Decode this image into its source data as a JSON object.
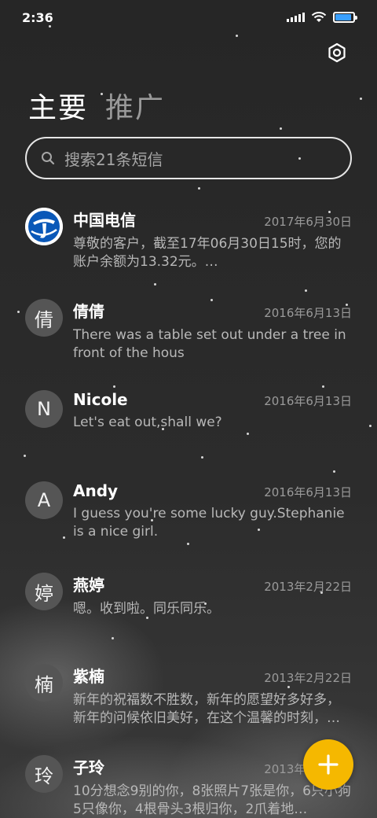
{
  "status_bar": {
    "time": "2:36",
    "icons": [
      "signal-icon",
      "wifi-icon",
      "battery-icon"
    ],
    "battery_level": 0.9
  },
  "header": {
    "settings_icon": "gear-icon",
    "tabs": [
      {
        "label": "主要",
        "active": true
      },
      {
        "label": "推广",
        "active": false
      }
    ]
  },
  "search": {
    "placeholder": "搜索21条短信",
    "icon": "search-icon"
  },
  "messages": [
    {
      "avatar": "",
      "avatar_icon": "china-telecom-logo",
      "name": "中国电信",
      "date": "2017年6月30日",
      "preview": "尊敬的客户，截至17年06月30日15时，您的账户余额为13.32元。…"
    },
    {
      "avatar": "倩",
      "name": "倩倩",
      "date": "2016年6月13日",
      "preview": "There was a table set out under a tree in front of the hous"
    },
    {
      "avatar": "N",
      "name": "Nicole",
      "date": "2016年6月13日",
      "preview": "Let's eat out,shall we?"
    },
    {
      "avatar": "A",
      "name": "Andy",
      "date": "2016年6月13日",
      "preview": "I guess you're some lucky guy.Stephanie is a nice girl."
    },
    {
      "avatar": "婷",
      "name": "燕婷",
      "date": "2013年2月22日",
      "preview": "嗯。收到啦。同乐同乐。"
    },
    {
      "avatar": "楠",
      "name": "紫楠",
      "date": "2013年2月22日",
      "preview": "新年的祝福数不胜数，新年的愿望好多好多，新年的问候依旧美好，在这个温馨的时刻，…"
    },
    {
      "avatar": "玲",
      "name": "子玲",
      "date": "2013年2月22日",
      "preview": "10分想念9别的你，8张照片7张是你，6只小狗5只像你，4根骨头3根归你，2爪着地…"
    }
  ],
  "fab": {
    "icon": "plus-icon",
    "color": "#f5b800"
  },
  "colors": {
    "accent": "#f5b800",
    "battery": "#3aa0ff"
  }
}
